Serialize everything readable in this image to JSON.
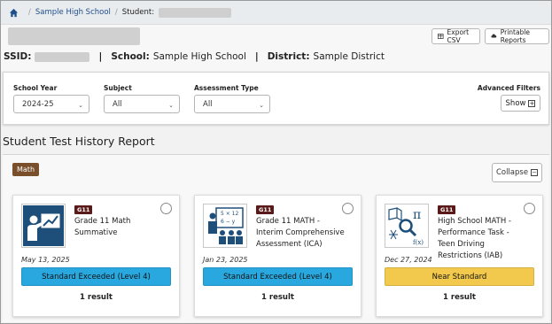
{
  "breadcrumb": {
    "school": "Sample High School",
    "student_label": "Student:"
  },
  "toolbar": {
    "export_label": "Export CSV",
    "print_label": "Printable Reports"
  },
  "ids": {
    "ssid_label": "SSID:",
    "school_label": "School:",
    "school_value": "Sample High School",
    "district_label": "District:",
    "district_value": "Sample District"
  },
  "filters": {
    "school_year": {
      "label": "School Year",
      "value": "2024-25"
    },
    "subject": {
      "label": "Subject",
      "value": "All"
    },
    "assessment_type": {
      "label": "Assessment Type",
      "value": "All"
    },
    "advanced": {
      "label": "Advanced Filters",
      "button": "Show"
    }
  },
  "report": {
    "title": "Student Test History Report",
    "subject_tag": "Math",
    "collapse_label": "Collapse"
  },
  "cards": [
    {
      "grade": "G11",
      "title": "Grade 11 Math Summative",
      "date": "May 13, 2025",
      "level": "Standard Exceeded (Level 4)",
      "level_color": "#29a8e0",
      "result": "1 result",
      "icon": "presenter-chart-icon"
    },
    {
      "grade": "G11",
      "title": "Grade 11 MATH - Interim Comprehensive Assessment (ICA)",
      "date": "Jan 23, 2025",
      "level": "Standard Exceeded (Level 4)",
      "level_color": "#29a8e0",
      "result": "1 result",
      "icon": "classroom-math-icon"
    },
    {
      "grade": "G11",
      "title": "High School MATH - Performance Task - Teen Driving Restrictions (IAB)",
      "date": "Dec 27, 2024",
      "level": "Near Standard",
      "level_color": "#f2c94c",
      "result": "1 result",
      "icon": "math-tools-icon"
    }
  ]
}
